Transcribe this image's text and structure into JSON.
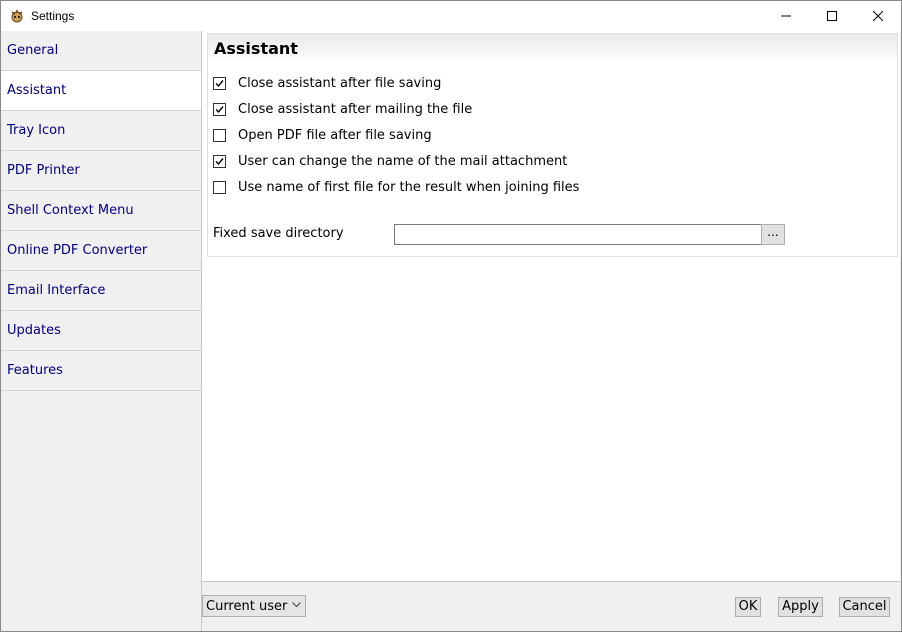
{
  "window": {
    "title": "Settings"
  },
  "sidebar": {
    "items": [
      {
        "label": "General"
      },
      {
        "label": "Assistant",
        "active": true
      },
      {
        "label": "Tray Icon"
      },
      {
        "label": "PDF Printer"
      },
      {
        "label": "Shell Context Menu"
      },
      {
        "label": "Online PDF Converter"
      },
      {
        "label": "Email Interface"
      },
      {
        "label": "Updates"
      },
      {
        "label": "Features"
      }
    ]
  },
  "panel": {
    "title": "Assistant",
    "options": [
      {
        "label": "Close assistant after file saving",
        "checked": true
      },
      {
        "label": "Close assistant after mailing the file",
        "checked": true
      },
      {
        "label": "Open PDF file after file saving",
        "checked": false
      },
      {
        "label": "User can change the name of the mail attachment",
        "checked": true
      },
      {
        "label": "Use name of first file for the result when joining files",
        "checked": false
      }
    ],
    "fixed_dir": {
      "label": "Fixed save directory",
      "value": "",
      "browse_label": "..."
    }
  },
  "footer": {
    "user_scope": "Current user",
    "ok_label": "OK",
    "apply_label": "Apply",
    "cancel_label": "Cancel"
  },
  "colors": {
    "nav_text": "#000080",
    "active_bg": "#ffffff",
    "window_bg": "#f0f0f0"
  }
}
